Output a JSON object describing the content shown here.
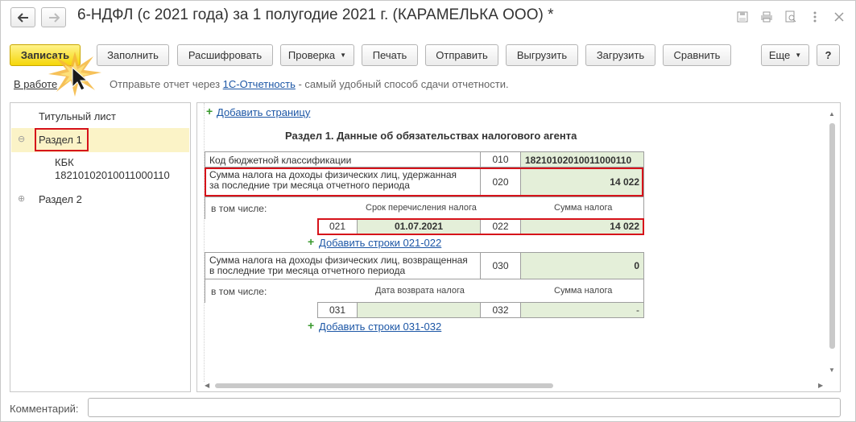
{
  "window": {
    "title": "6-НДФЛ (с 2021 года) за 1 полугодие 2021 г. (КАРАМЕЛЬКА ООО) *",
    "icons": [
      "back-icon",
      "forward-icon",
      "save-icon",
      "print-icon",
      "preview-icon",
      "more-icon",
      "close-icon"
    ]
  },
  "toolbar": {
    "save": "Записать",
    "fill": "Заполнить",
    "decode": "Расшифровать",
    "check": "Проверка",
    "print": "Печать",
    "send": "Отправить",
    "export": "Выгрузить",
    "import": "Загрузить",
    "compare": "Сравнить",
    "more": "Еще",
    "help": "?"
  },
  "info": {
    "status": "В работе",
    "text_before": "Отправьте отчет через ",
    "link": "1С-Отчетность",
    "text_after": " - самый удобный способ сдачи отчетности."
  },
  "tree": {
    "title_page": "Титульный лист",
    "section1": "Раздел 1",
    "kbk_label": "КБК",
    "kbk_value": "18210102010011000110",
    "section2": "Раздел 2"
  },
  "form": {
    "add_page": "Добавить страницу",
    "section_title": "Раздел 1. Данные об обязательствах налогового агента",
    "kbk_label": "Код бюджетной классификации",
    "kbk_code": "010",
    "kbk_value": "18210102010011000110",
    "withheld_label_1": "Сумма налога на доходы физических лиц, удержанная",
    "withheld_label_2": "за последние три месяца отчетного периода",
    "withheld_code": "020",
    "withheld_value": "14 022",
    "including_1": "в том числе:",
    "transfer_date_hdr": "Срок перечисления налога",
    "tax_sum_hdr_1": "Сумма налога",
    "row021_code": "021",
    "row021_value": "01.07.2021",
    "row022_code": "022",
    "row022_value": "14 022",
    "add_rows_021": "Добавить строки 021-022",
    "returned_label_1": "Сумма налога на доходы физических лиц, возвращенная",
    "returned_label_2": "в последние три месяца отчетного периода",
    "returned_code": "030",
    "returned_value": "0",
    "including_2": "в том числе:",
    "return_date_hdr": "Дата возврата налога",
    "tax_sum_hdr_2": "Сумма налога",
    "row031_code": "031",
    "row031_value": "",
    "row032_code": "032",
    "row032_value": "-",
    "add_rows_031": "Добавить строки 031-032"
  },
  "comment": {
    "label": "Комментарий:",
    "value": ""
  },
  "colors": {
    "accent_yellow": "#f5d60a",
    "highlight_red": "#d6121a",
    "link_blue": "#1d57a6",
    "cell_green": "#e4efd9"
  }
}
